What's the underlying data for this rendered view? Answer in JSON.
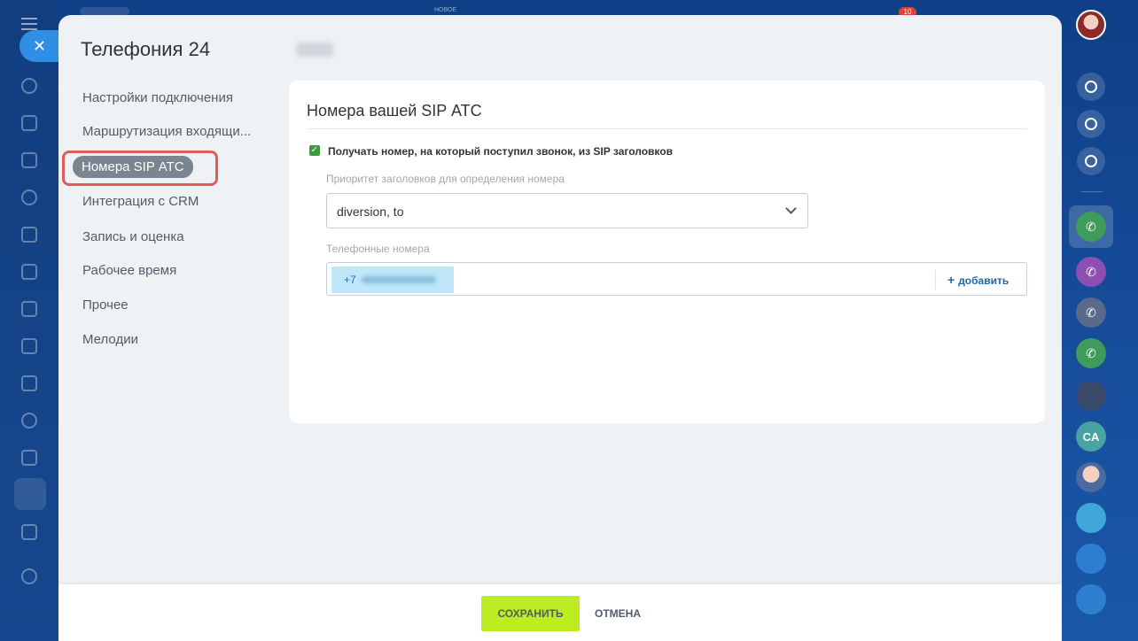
{
  "top_strip": {
    "label": "НОВОЕ",
    "badge": "10"
  },
  "slider": {
    "close_icon": "close-icon",
    "title": "Телефония 24"
  },
  "nav": {
    "items": [
      {
        "label": "Настройки подключения"
      },
      {
        "label": "Маршрутизация входящи..."
      },
      {
        "label": "Номера SIP АТС"
      },
      {
        "label": "Интеграция с CRM"
      },
      {
        "label": "Запись и оценка"
      },
      {
        "label": "Рабочее время"
      },
      {
        "label": "Прочее"
      },
      {
        "label": "Мелодии"
      }
    ],
    "active_index": 2
  },
  "card": {
    "title": "Номера вашей SIP АТС",
    "checkbox_label": "Получать номер, на который поступил звонок, из SIP заголовков",
    "checkbox_checked": true,
    "priority_label": "Приоритет заголовков для определения номера",
    "priority_value": "diversion, to",
    "phones_label": "Телефонные номера",
    "phone_tag_prefix": "+7",
    "add_label": "добавить"
  },
  "footer": {
    "save_label": "СОХРАНИТЬ",
    "cancel_label": "ОТМЕНА"
  },
  "right_sidebar": {
    "initials_avatar": "CA"
  },
  "colors": {
    "accent_save": "#bbed21",
    "nav_active": "#7b8591",
    "highlight": "#e05a5f",
    "link": "#2067b0"
  }
}
